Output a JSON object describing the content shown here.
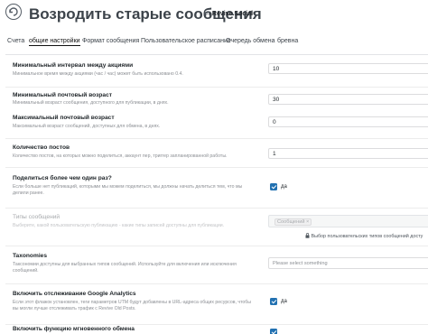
{
  "header": {
    "title": "Возродить старые сообщения",
    "by_prefix": "от",
    "by_name": "Revive.Social"
  },
  "tabs": [
    {
      "label": "Счета",
      "active": false
    },
    {
      "label": "общие настройки",
      "active": true
    },
    {
      "label": "Формат сообщения",
      "active": false
    },
    {
      "label": "Пользовательское расписание",
      "active": false
    },
    {
      "label": "Очередь обмена",
      "active": false
    },
    {
      "label": "бревна",
      "active": false
    }
  ],
  "settings": {
    "min_interval": {
      "label": "Минимальный интервал между акциями",
      "description": "Минимальное время между акциями (час / час) может быть использовано 0.4.",
      "value": "10"
    },
    "min_age": {
      "label": "Минимальный почтовый возраст",
      "description": "Минимальный возраст сообщения, доступного для публикации, в днях.",
      "value": "30"
    },
    "max_age": {
      "label": "Максимальный почтовый возраст",
      "description": "Максимальный возраст сообщений, доступных для обмена, в днях.",
      "value": "0"
    },
    "post_count": {
      "label": "Количество постов",
      "description": "Количество постов, на которых можно поделиться, аккаунт пер, триггер запланированной работы.",
      "value": "1"
    },
    "share_more": {
      "label": "Поделиться более чем один раз?",
      "description": "Если больше нет публикаций, которыми мы можем поделиться, мы должны начать делиться тем, что мы делили ранее.",
      "checked": true,
      "check_label": "да"
    },
    "post_types": {
      "label": "Типы сообщений",
      "description": "Выберите, какой пользовательскую публикацию - какие типы записей доступны для публикации.",
      "chip": "Сообщений",
      "chip_remove": "×",
      "lock_note": "Выбор пользовательских типов сообщений досту",
      "lock_icon": "lock-icon"
    },
    "taxonomies": {
      "label": "Taxonomies",
      "description": "Таксономии доступны для выбранных типов сообщений. Используйте для включения или исключения сообщений.",
      "placeholder": "Please select something"
    },
    "ga_tracking": {
      "label": "Включить отслеживание Google Analytics",
      "description": "Если этот флажок установлен, теги параметров UTM будут добавлены в URL-адреса общих ресурсов, чтобы вы могли лучше отслеживать трафик с Revive Old Posts.",
      "checked": true,
      "check_label": "да"
    },
    "instant_share": {
      "label": "Включить функцию мгновенного обмена",
      "checked": true
    }
  },
  "colors": {
    "accent": "#2271b1",
    "text": "#23282d",
    "muted": "#8c8f94"
  }
}
